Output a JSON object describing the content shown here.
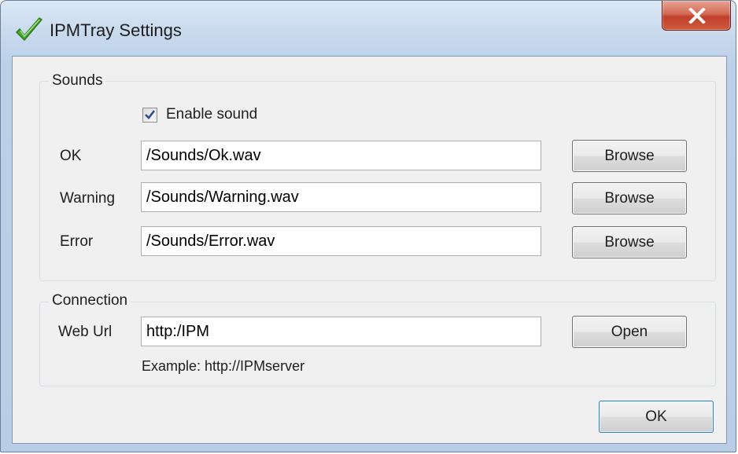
{
  "window": {
    "title": "IPMTray Settings",
    "icons": {
      "app": "green-checkmark-icon",
      "close": "close-x-icon"
    }
  },
  "sounds": {
    "group_label": "Sounds",
    "enable_sound_label": "Enable sound",
    "enable_sound_checked": true,
    "rows": [
      {
        "label": "OK",
        "value": "/Sounds/Ok.wav",
        "button": "Browse"
      },
      {
        "label": "Warning",
        "value": "/Sounds/Warning.wav",
        "button": "Browse"
      },
      {
        "label": "Error",
        "value": "/Sounds/Error.wav",
        "button": "Browse"
      }
    ]
  },
  "connection": {
    "group_label": "Connection",
    "web_url_label": "Web Url",
    "web_url_value": "http:/IPM",
    "open_button": "Open",
    "example_text": "Example: http://IPMserver"
  },
  "footer": {
    "ok_button": "OK"
  },
  "colors": {
    "titlebar": "#c9daee",
    "client_bg": "#f0f0f0",
    "close_button": "#c74a33",
    "checkmark": "#3d9a2a"
  }
}
